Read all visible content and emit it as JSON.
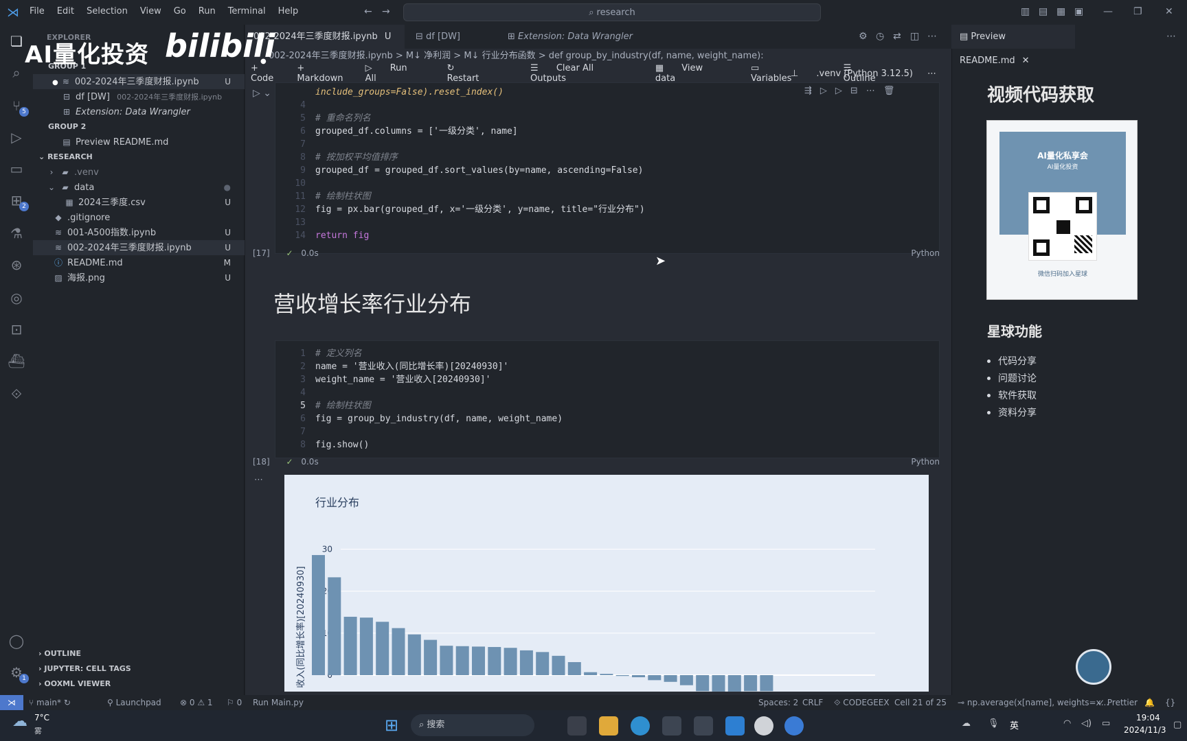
{
  "menu": [
    "File",
    "Edit",
    "Selection",
    "View",
    "Go",
    "Run",
    "Terminal",
    "Help"
  ],
  "search": {
    "text": "research"
  },
  "overlay": {
    "logo": "AI量化投资",
    "bili": "bilibili"
  },
  "sidebar": {
    "title": "EXPLORER",
    "group1": "GROUP 1",
    "g1_items": [
      {
        "label": "002-2024年三季度财报.ipynb",
        "status": "U"
      },
      {
        "label": "df [DW]",
        "desc": "002-2024年三季度财报.ipynb"
      },
      {
        "label": "Extension: Data Wrangler"
      }
    ],
    "group2": "GROUP 2",
    "g2_items": [
      {
        "label": "Preview README.md"
      }
    ],
    "research": "RESEARCH",
    "tree": [
      {
        "label": ".venv"
      },
      {
        "label": "data"
      },
      {
        "label": "2024三季度.csv",
        "status": "U"
      },
      {
        "label": ".gitignore"
      },
      {
        "label": "001-A500指数.ipynb",
        "status": "U"
      },
      {
        "label": "002-2024年三季度财报.ipynb",
        "status": "U"
      },
      {
        "label": "README.md",
        "status": "M"
      },
      {
        "label": "海报.png",
        "status": "U"
      }
    ],
    "outline": "OUTLINE",
    "jupyter_tags": "JUPYTER: CELL TAGS",
    "ooxml": "OOXML VIEWER"
  },
  "tabs": [
    {
      "label": "002-2024年三季度财报.ipynb",
      "status": "U"
    },
    {
      "label": "df [DW]"
    },
    {
      "label": "Extension: Data Wrangler"
    }
  ],
  "breadcrumb": "002-2024年三季度财报.ipynb  >  M↓ 净利润  >  M↓ 行业分布函数  >  def group_by_industry(df, name, weight_name):",
  "toolbar": {
    "code": "+ Code",
    "markdown": "+ Markdown",
    "run_all": "Run All",
    "restart": "Restart",
    "clear": "Clear All Outputs",
    "view_data": "View data",
    "variables": "Variables",
    "outline": "Outline",
    "kernel": ".venv (Python 3.12.5)"
  },
  "cell1": {
    "lines": [
      {
        "n": "",
        "t": "include_groups=False).reset_index()"
      },
      {
        "n": "4",
        "t": ""
      },
      {
        "n": "5",
        "t": "# 重命名列名"
      },
      {
        "n": "6",
        "t": "grouped_df.columns = ['一级分类', name]"
      },
      {
        "n": "7",
        "t": ""
      },
      {
        "n": "8",
        "t": "# 按加权平均值排序"
      },
      {
        "n": "9",
        "t": "grouped_df = grouped_df.sort_values(by=name, ascending=False)"
      },
      {
        "n": "10",
        "t": ""
      },
      {
        "n": "11",
        "t": "# 绘制柱状图"
      },
      {
        "n": "12",
        "t": "fig = px.bar(grouped_df, x='一级分类', y=name, title=\"行业分布\")"
      },
      {
        "n": "13",
        "t": ""
      },
      {
        "n": "14",
        "t": "return fig"
      }
    ],
    "exec": "[17]",
    "time": "0.0s",
    "lang": "Python"
  },
  "md_heading": "营收增长率行业分布",
  "cell2": {
    "lines": [
      {
        "n": "1",
        "t": "# 定义列名"
      },
      {
        "n": "2",
        "t": "name = '营业收入(同比增长率)[20240930]'"
      },
      {
        "n": "3",
        "t": "weight_name = '营业收入[20240930]'"
      },
      {
        "n": "4",
        "t": ""
      },
      {
        "n": "5",
        "t": "# 绘制柱状图"
      },
      {
        "n": "6",
        "t": "fig = group_by_industry(df, name, weight_name)"
      },
      {
        "n": "7",
        "t": ""
      },
      {
        "n": "8",
        "t": "fig.show()"
      }
    ],
    "exec": "[18]",
    "time": "0.0s",
    "lang": "Python"
  },
  "chart_data": {
    "type": "bar",
    "title": "行业分布",
    "ylabel": "收入(同比增长率)[20240930]",
    "ylim": [
      -4,
      30
    ],
    "yticks": [
      0,
      10,
      20,
      30
    ],
    "values": [
      28.6,
      23.3,
      13.9,
      13.7,
      12.7,
      11.2,
      9.7,
      8.4,
      7.0,
      6.9,
      6.8,
      6.7,
      6.5,
      5.9,
      5.5,
      4.6,
      3.1,
      0.7,
      0.3,
      -0.2,
      -0.5,
      -1.2,
      -1.6,
      -2.4,
      -3.8,
      -3.9,
      -3.9,
      -3.8,
      -3.8
    ],
    "bar_color": "#6e92b2"
  },
  "preview_tab": "Preview README.md",
  "readme": {
    "h1": "视频代码获取",
    "qr_title": "AI量化私享会",
    "qr_sub": "AI量化投资",
    "qr_caption": "微信扫码加入星球",
    "h2": "星球功能",
    "items": [
      "代码分享",
      "问题讨论",
      "软件获取",
      "资料分享"
    ]
  },
  "status": {
    "branch": "main*",
    "errors": "⊗ 0 ⚠ 1",
    "ports": "0",
    "launchpad": "Launchpad",
    "run": "Run Main.py",
    "spaces": "Spaces: 2",
    "eol": "CRLF",
    "codegeex": "CODEGEEX",
    "cell": "Cell 21 of 25",
    "hint": "np.average(x[name], weights=x...",
    "prettier": "Prettier"
  },
  "taskbar": {
    "weather": "7°C",
    "weather_sub": "雾",
    "search": "搜索",
    "time": "19:04",
    "date": "2024/11/3",
    "ime": "英"
  }
}
